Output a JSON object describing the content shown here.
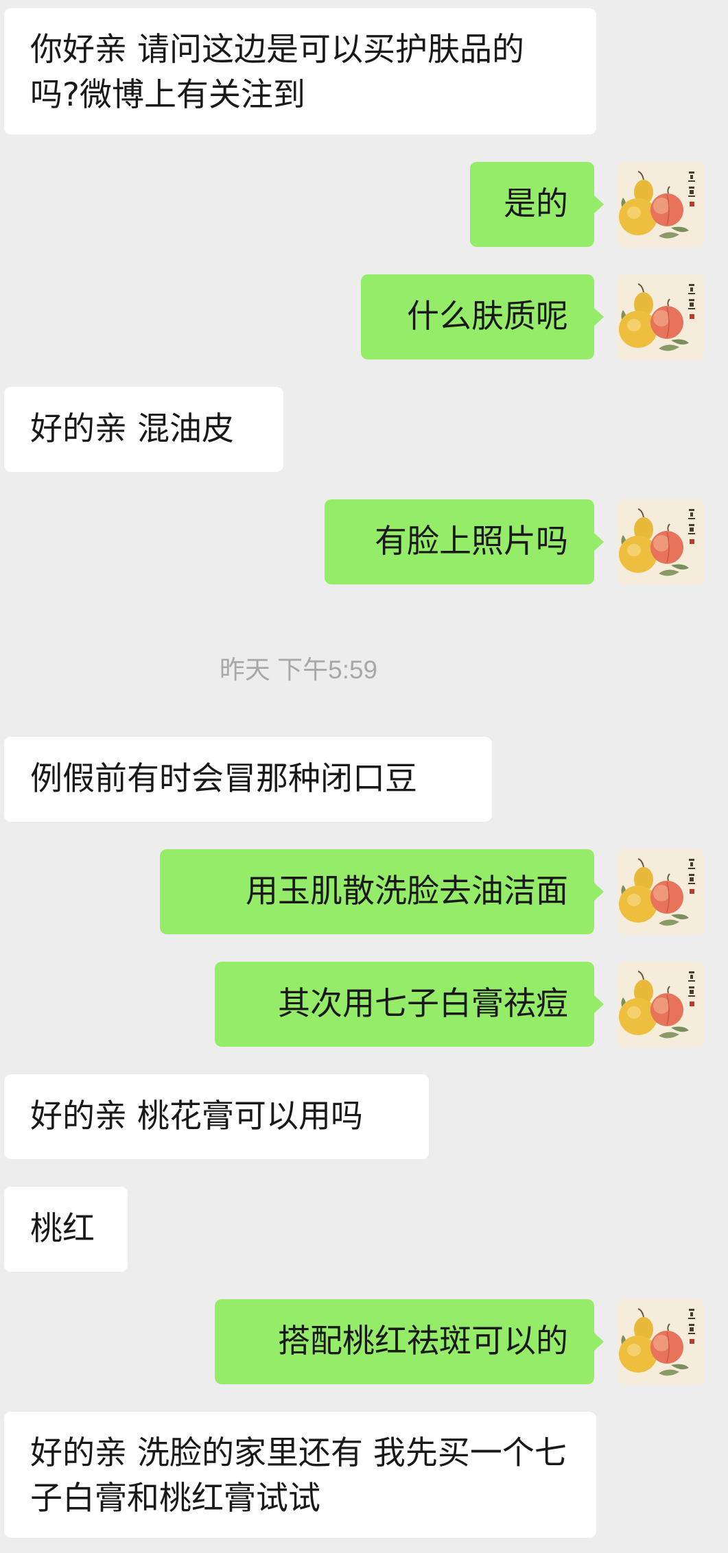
{
  "messages": [
    {
      "side": "in",
      "text": "你好亲 请问这边是可以买护肤品的吗?微博上有关注到"
    },
    {
      "side": "out",
      "text": "是的"
    },
    {
      "side": "out",
      "text": "什么肤质呢"
    },
    {
      "side": "in",
      "text": "好的亲 混油皮"
    },
    {
      "side": "out",
      "text": "有脸上照片吗"
    },
    {
      "side": "in",
      "text": "例假前有时会冒那种闭口豆"
    },
    {
      "side": "out",
      "text": "用玉肌散洗脸去油洁面"
    },
    {
      "side": "out",
      "text": "其次用七子白膏祛痘"
    },
    {
      "side": "in",
      "text": "好的亲 桃花膏可以用吗"
    },
    {
      "side": "in",
      "text": "桃红"
    },
    {
      "side": "out",
      "text": "搭配桃红祛斑可以的"
    },
    {
      "side": "in",
      "text": "好的亲 洗脸的家里还有 我先买一个七子白膏和桃红膏试试"
    }
  ],
  "timestamp": "昨天 下午5:59",
  "avatar_seal_text": "福禄",
  "colors": {
    "background": "#ededed",
    "incoming_bubble": "#ffffff",
    "outgoing_bubble": "#95ec69",
    "text": "#191919",
    "timestamp": "#a8a8a8"
  },
  "icons": {
    "avatar": "pear-peach-painting-avatar"
  }
}
